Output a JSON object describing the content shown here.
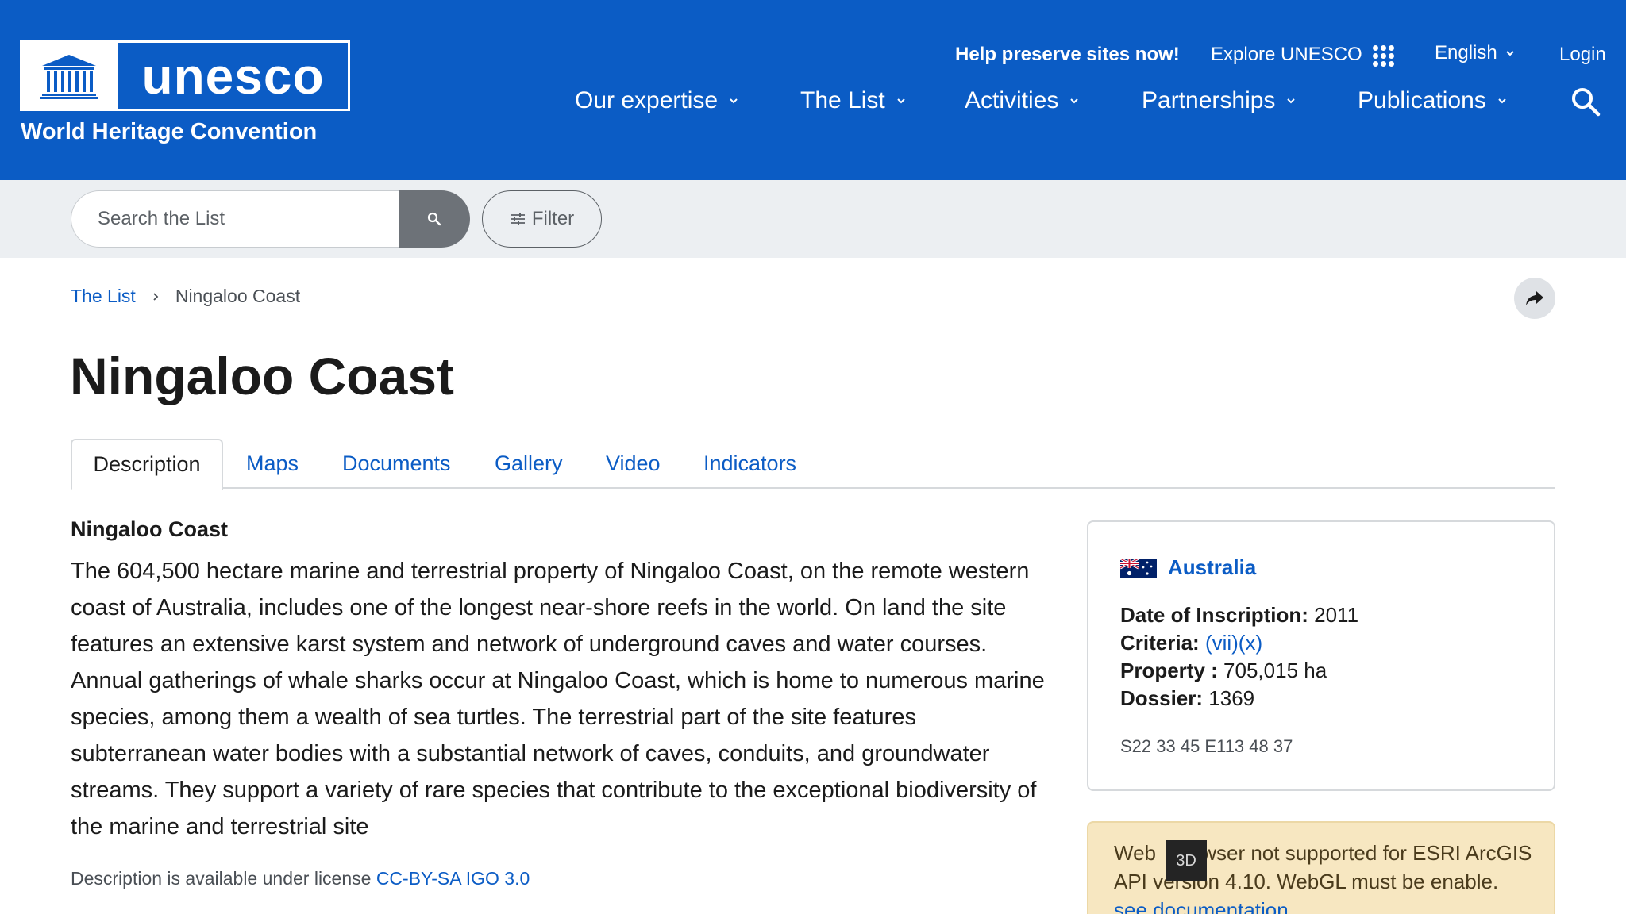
{
  "header": {
    "brand": "unesco",
    "subtitle": "World Heritage Convention",
    "help_link": "Help preserve sites now!",
    "explore": "Explore UNESCO",
    "language": "English",
    "login": "Login",
    "nav": [
      {
        "label": "Our expertise"
      },
      {
        "label": "The List"
      },
      {
        "label": "Activities"
      },
      {
        "label": "Partnerships"
      },
      {
        "label": "Publications"
      }
    ]
  },
  "search": {
    "placeholder": "Search the List",
    "filter_label": "Filter"
  },
  "breadcrumb": {
    "root": "The List",
    "current": "Ningaloo Coast"
  },
  "page": {
    "title": "Ningaloo Coast"
  },
  "tabs": [
    {
      "label": "Description"
    },
    {
      "label": "Maps"
    },
    {
      "label": "Documents"
    },
    {
      "label": "Gallery"
    },
    {
      "label": "Video"
    },
    {
      "label": "Indicators"
    }
  ],
  "description": {
    "heading": "Ningaloo Coast",
    "body": "The 604,500 hectare marine and terrestrial property of Ningaloo Coast, on the remote western coast of Australia, includes one of the longest near-shore reefs in the world. On land the site features an extensive karst system and network of underground caves and water courses. Annual gatherings of whale sharks occur at Ningaloo Coast, which is home to numerous marine species, among them a wealth of sea turtles. The terrestrial part of the site features subterranean water bodies with a substantial network of caves, conduits, and groundwater streams. They support a variety of rare species that contribute to the exceptional biodiversity of the marine and terrestrial site",
    "license_prefix": "Description is available under license",
    "license_link": "CC-BY-SA IGO 3.0"
  },
  "info": {
    "country": "Australia",
    "inscription_label": "Date of Inscription:",
    "inscription_value": "2011",
    "criteria_label": "Criteria:",
    "criteria_value": "(vii)(x)",
    "property_label": "Property :",
    "property_value": "705,015 ha",
    "dossier_label": "Dossier:",
    "dossier_value": "1369",
    "coords": "S22 33 45 E113 48 37"
  },
  "map_warning": {
    "text_before": "Web ",
    "text_rest": "wser not supported for ESRI ArcGIS API version 4.10. WebGL must be enable. ",
    "link": "see documentation",
    "btn_3d": "3D"
  },
  "colors": {
    "header_bg": "#0b5cc5",
    "link": "#0b5cc5",
    "strip_bg": "#eceff2",
    "warning_bg": "#f7e7c1"
  },
  "icons": {
    "emblem": "unesco-temple-emblem-icon",
    "apps": "apps-grid-icon",
    "search": "search-icon",
    "filter": "filter-sliders-icon",
    "share": "share-arrow-icon",
    "flag": "australia-flag-icon"
  }
}
